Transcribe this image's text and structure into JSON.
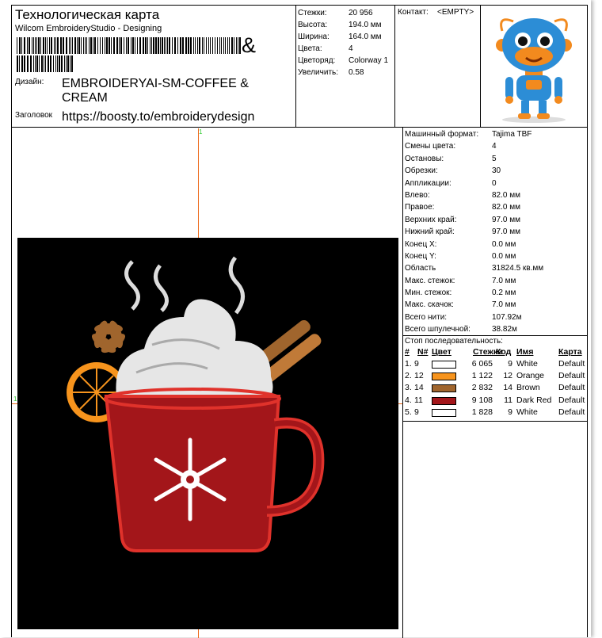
{
  "header": {
    "title": "Технологическая карта",
    "subtitle": "Wilcom EmbroideryStudio - Designing",
    "barcode_suffix": "&",
    "design_label": "Дизайн:",
    "design_value": "EMBROIDERYAI-SM-COFFEE & CREAM",
    "heading_label": "Заголовок",
    "heading_value": "https://boosty.to/embroiderydesign"
  },
  "summary": [
    {
      "label": "Стежки:",
      "value": "20 956"
    },
    {
      "label": "Высота:",
      "value": "194.0 мм"
    },
    {
      "label": "Ширина:",
      "value": "164.0 мм"
    },
    {
      "label": "Цвета:",
      "value": "4"
    },
    {
      "label": "Цветоряд:",
      "value": "Colorway 1"
    },
    {
      "label": "Увеличить:",
      "value": "0.58"
    }
  ],
  "contact": {
    "label": "Контакт:",
    "value": "<EMPTY>"
  },
  "canvas": {
    "marker_top": "1",
    "marker_left": "1",
    "marker_right": "1"
  },
  "machine": [
    {
      "label": "Машинный формат:",
      "value": "Tajima TBF"
    },
    {
      "label": "Смены цвета:",
      "value": "4"
    },
    {
      "label": "Остановы:",
      "value": "5"
    },
    {
      "label": "Обрезки:",
      "value": "30"
    },
    {
      "label": "Аппликации:",
      "value": "0"
    },
    {
      "label": "Влево:",
      "value": "82.0 мм"
    },
    {
      "label": "Правое:",
      "value": "82.0 мм"
    },
    {
      "label": "Верхних край:",
      "value": "97.0 мм"
    },
    {
      "label": "Нижний край:",
      "value": "97.0 мм"
    },
    {
      "label": "Конец X:",
      "value": "0.0 мм"
    },
    {
      "label": "Конец Y:",
      "value": "0.0 мм"
    },
    {
      "label": "Область",
      "value": "31824.5 кв.мм"
    },
    {
      "label": "Макс. стежок:",
      "value": "7.0 мм"
    },
    {
      "label": "Мин. стежок:",
      "value": "0.2 мм"
    },
    {
      "label": "Макс. скачок:",
      "value": "7.0 мм"
    },
    {
      "label": "Всего нити:",
      "value": "107.92м"
    },
    {
      "label": "Всего шпулечной:",
      "value": "38.82м"
    }
  ],
  "stops": {
    "title": "Стоп последовательность:",
    "headers": [
      "#",
      "N#",
      "Цвет",
      "Стежки",
      "Код",
      "Имя",
      "Карта"
    ],
    "rows": [
      {
        "num": "1.",
        "n": "9",
        "color": "#ffffff",
        "stitches": "6 065",
        "code": "9",
        "name": "White",
        "map": "Default"
      },
      {
        "num": "2.",
        "n": "12",
        "color": "#f7941d",
        "stitches": "1 122",
        "code": "12",
        "name": "Orange",
        "map": "Default"
      },
      {
        "num": "3.",
        "n": "14",
        "color": "#a0652d",
        "stitches": "2 832",
        "code": "14",
        "name": "Brown",
        "map": "Default"
      },
      {
        "num": "4.",
        "n": "11",
        "color": "#a3161a",
        "stitches": "9 108",
        "code": "11",
        "name": "Dark Red",
        "map": "Default"
      },
      {
        "num": "5.",
        "n": "9",
        "color": "#ffffff",
        "stitches": "1 828",
        "code": "9",
        "name": "White",
        "map": "Default"
      }
    ]
  }
}
